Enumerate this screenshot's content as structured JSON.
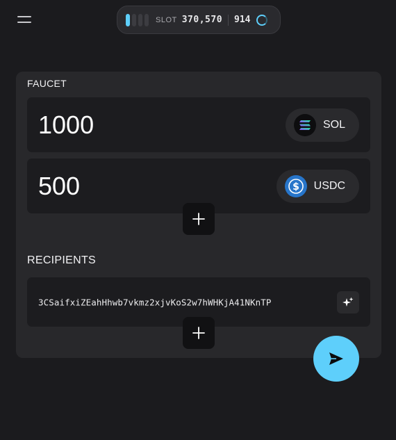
{
  "header": {
    "slot_label": "SLOT",
    "slot_value": "370,570",
    "count_value": "914",
    "slot_bars_active": 1,
    "slot_bars_total": 4,
    "accent_color": "#5ecffb",
    "menu_icon": "hamburger-menu-icon",
    "spinner_icon": "loading-spinner-icon"
  },
  "faucet": {
    "title": "FAUCET",
    "rows": [
      {
        "amount": "1000",
        "token_label": "SOL",
        "token_icon": "solana-icon"
      },
      {
        "amount": "500",
        "token_label": "USDC",
        "token_icon": "usdc-icon"
      }
    ],
    "add_icon": "plus-icon"
  },
  "recipients": {
    "title": "RECIPIENTS",
    "items": [
      {
        "address": "3CSaifxiZEahHhwb7vkmz2xjvKoS2w7hWHKjA41NKnTP",
        "action_icon": "sparkle-icon"
      }
    ],
    "add_icon": "plus-icon"
  },
  "send_icon": "send-icon"
}
